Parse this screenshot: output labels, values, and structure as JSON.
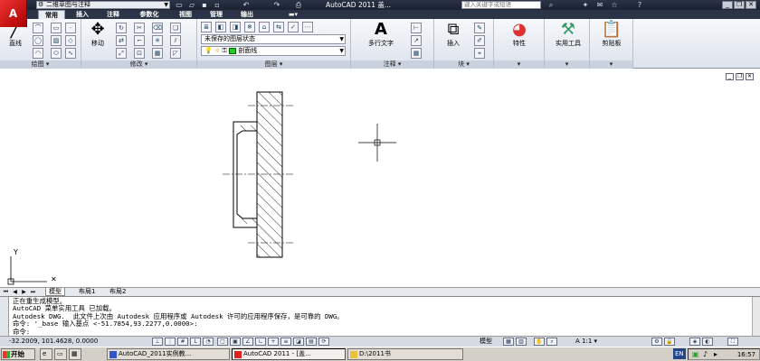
{
  "title_bar": {
    "workspace": "二维草图与注释",
    "title": "AutoCAD 2011   盖...",
    "search_placeholder": "键入关键字或短语"
  },
  "ribbon_tabs": [
    {
      "label": "常用",
      "active": true
    },
    {
      "label": "插入"
    },
    {
      "label": "注释"
    },
    {
      "label": "参数化"
    },
    {
      "label": "视图"
    },
    {
      "label": "管理"
    },
    {
      "label": "输出"
    }
  ],
  "ribbon": {
    "draw": {
      "line_label": "直线",
      "panel_label": "绘图"
    },
    "modify": {
      "move_label": "移动",
      "panel_label": "修改"
    },
    "layers": {
      "state_combo": "未保存的图层状态",
      "layer_combo": "剖面线",
      "panel_label": "图层",
      "layer_color": "#22cc22"
    },
    "annotation": {
      "mtext_label": "多行文字",
      "panel_label": "注释"
    },
    "block": {
      "insert_label": "插入",
      "panel_label": "块"
    },
    "properties": {
      "label": "特性"
    },
    "utilities": {
      "label": "实用工具"
    },
    "clipboard": {
      "label": "剪贴板"
    }
  },
  "layout_tabs": [
    "模型",
    "布局1",
    "布局2"
  ],
  "command_lines": [
    "正在重生成模型。",
    "AutoCAD 菜单实用工具 已加载。",
    "Autodesk DWG.  此文件上次由 Autodesk 应用程序或 Autodesk 许可的应用程序保存，是可靠的 DWG。",
    "命令: '_base 输入基点 <-51.7854,93.2277,0.0000>:",
    "命令:"
  ],
  "status": {
    "coords": "-32.2009, 101.4628, 0.0000",
    "model_label": "模型",
    "scale": "1:1"
  },
  "taskbar": {
    "start_label": "开始",
    "tasks": [
      "AutoCAD_2011实例教...",
      "AutoCAD 2011 - [盖...",
      "D:\\2011书"
    ],
    "lang": "EN",
    "clock": "16:57"
  }
}
